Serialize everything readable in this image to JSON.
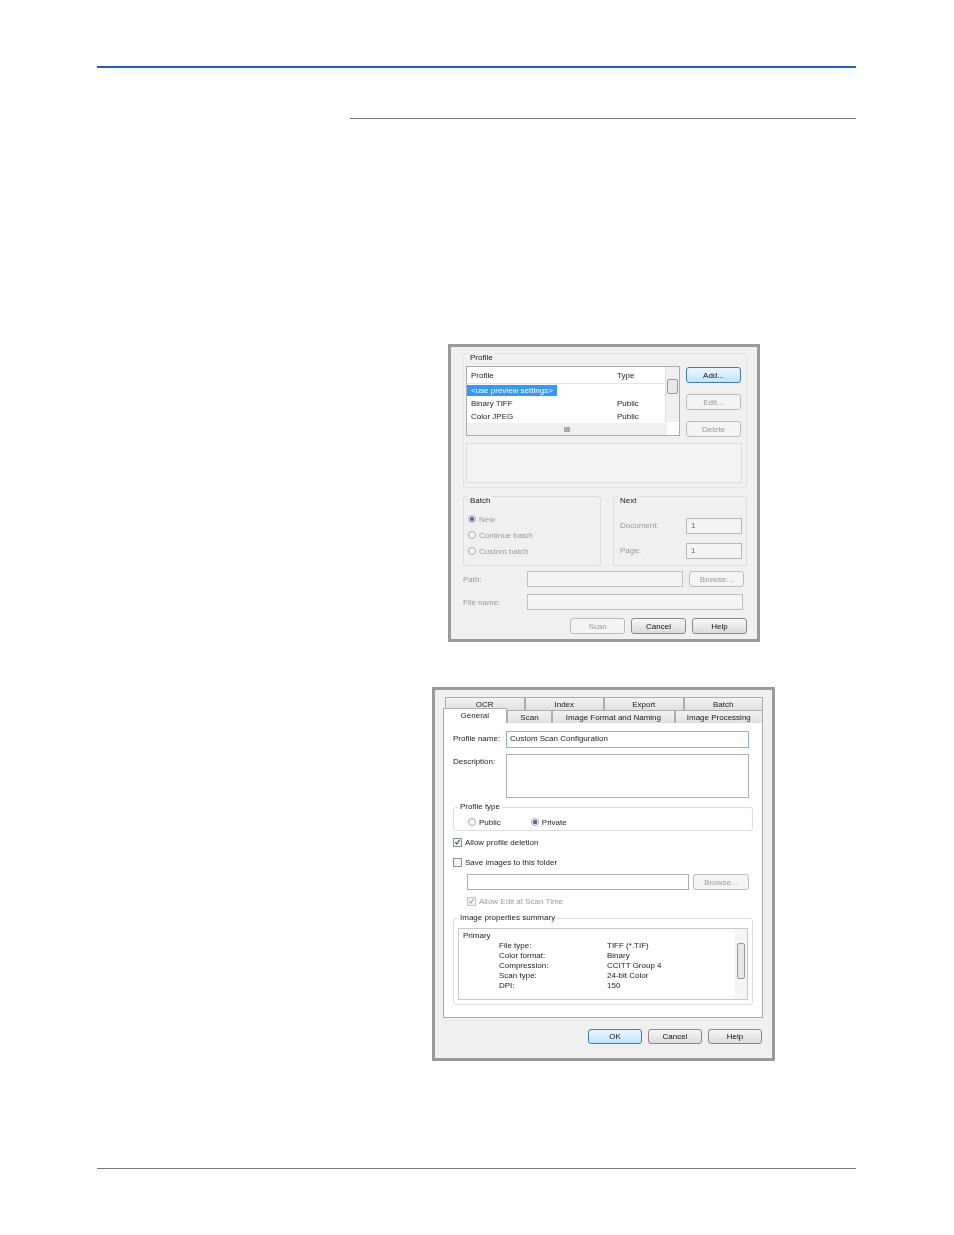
{
  "profile_dialog": {
    "profile_group": {
      "label": "Profile",
      "columns": [
        "Profile",
        "Type"
      ],
      "rows": [
        {
          "profile": "<use preview settings>",
          "selected": true
        },
        {
          "profile": "Binary TIFF",
          "type": "Public",
          "selected": false
        },
        {
          "profile": "Color JPEG",
          "type": "Public",
          "selected": false
        }
      ],
      "scroll_grip": "III",
      "buttons": [
        {
          "label": "Add...",
          "disabled": false,
          "default": true
        },
        {
          "label": "Edit...",
          "disabled": true,
          "default": false
        },
        {
          "label": "Delete",
          "disabled": true,
          "default": false
        }
      ]
    },
    "batch": {
      "label": "Batch",
      "options": [
        {
          "label": "New",
          "selected": true
        },
        {
          "label": "Continue batch",
          "selected": false
        },
        {
          "label": "Custom batch",
          "selected": false
        }
      ]
    },
    "next": {
      "label": "Next",
      "fields": [
        {
          "label": "Document:",
          "value": "1"
        },
        {
          "label": "Page:",
          "value": "1"
        }
      ]
    },
    "path_label": "Path:",
    "browse": "Browse...",
    "file_name_label": "File name:",
    "buttons": [
      {
        "label": "Scan",
        "disabled": true
      },
      {
        "label": "Cancel",
        "disabled": false
      },
      {
        "label": "Help",
        "disabled": false
      }
    ]
  },
  "config_dialog": {
    "tabs_back": [
      {
        "label": "OCR"
      },
      {
        "label": "Index"
      },
      {
        "label": "Export"
      },
      {
        "label": "Batch"
      }
    ],
    "tabs_front": [
      {
        "label": "General",
        "selected": true
      },
      {
        "label": "Scan",
        "selected": false
      },
      {
        "label": "Image Format and Naming",
        "selected": false
      },
      {
        "label": "Image Processing",
        "selected": false
      }
    ],
    "profile_name_label": "Profile name:",
    "profile_name": "Custom Scan Configuration",
    "description_label": "Description:",
    "profile_type": {
      "label": "Profile type",
      "options": [
        {
          "label": "Public",
          "selected": false
        },
        {
          "label": "Private",
          "selected": true
        }
      ]
    },
    "checks": [
      {
        "label": "Allow profile deletion",
        "checked": true,
        "disabled": false
      },
      {
        "label": "Save images to this folder",
        "checked": false,
        "disabled": false
      }
    ],
    "browse": "Browse...",
    "allow_edit": {
      "label": "Allow Edit at Scan Time",
      "checked": true,
      "disabled": true
    },
    "summary": {
      "label": "Image properties summary",
      "heading": "Primary",
      "rows": [
        {
          "name": "File type:",
          "value": "TIFF (*.TIF)"
        },
        {
          "name": "Color format:",
          "value": "Binary"
        },
        {
          "name": "Compression:",
          "value": "CCITT Group 4"
        },
        {
          "name": "Scan type:",
          "value": "24-bit Color"
        },
        {
          "name": "DPI:",
          "value": "150"
        }
      ]
    },
    "buttons": [
      {
        "label": "OK",
        "default": true
      },
      {
        "label": "Cancel",
        "default": false
      },
      {
        "label": "Help",
        "default": false
      }
    ]
  }
}
